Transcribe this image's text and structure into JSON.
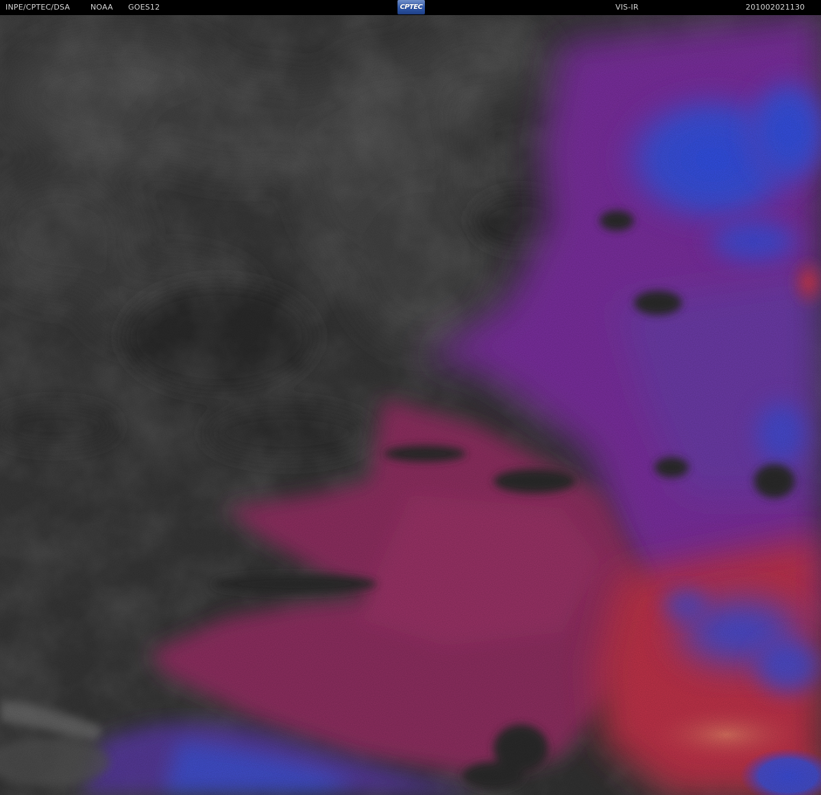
{
  "header": {
    "organization": "INPE/CPTEC/DSA",
    "agency": "NOAA",
    "satellite": "GOES12",
    "logo_text": "CPTEC",
    "channel": "VIS-IR",
    "timestamp": "201002021130"
  },
  "colors": {
    "header_bg": "#000000",
    "header_text": "#d8d8d8",
    "background_gray": "#3a3a3a",
    "night_gray": "#333333",
    "magenta_cloud": "#8e2f60",
    "red_cloud": "#c0304a",
    "purple_cloud": "#7a2e9e",
    "blue_cloud": "#2f4fe0",
    "logo_blue": "#2f57a8"
  }
}
